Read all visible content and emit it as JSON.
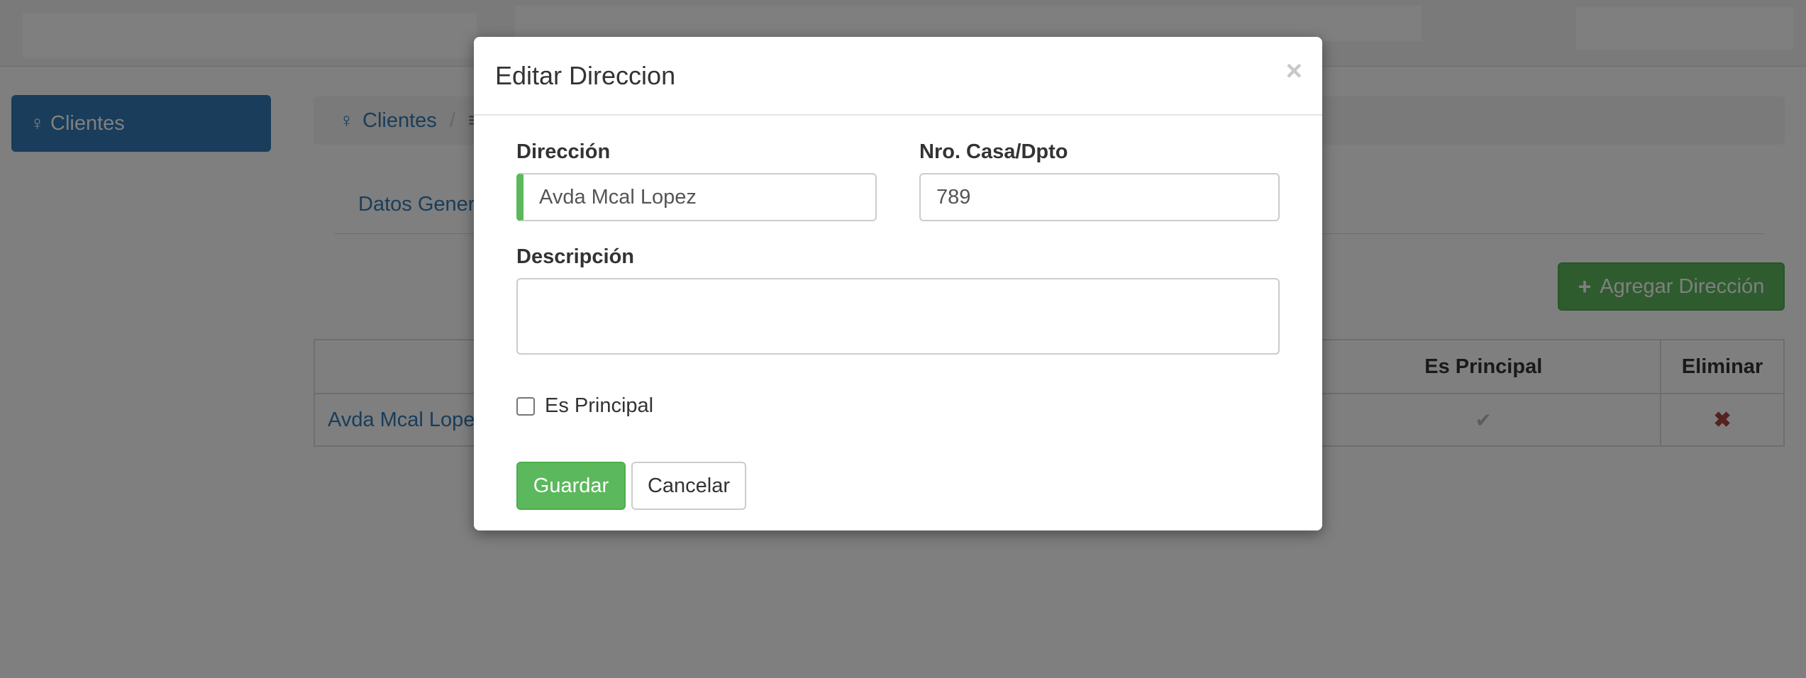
{
  "sidebar": {
    "clientes_label": "Clientes",
    "clientes_icon": "user-icon"
  },
  "breadcrumb": {
    "item1": "Clientes",
    "separator": "/"
  },
  "tabs": {
    "datos_generales": "Datos Genera"
  },
  "actions": {
    "add_address": "Agregar Dirección"
  },
  "table": {
    "headers": {
      "es_principal": "Es Principal",
      "eliminar": "Eliminar"
    },
    "rows": [
      {
        "direccion": "Avda Mcal Lopez"
      }
    ]
  },
  "modal": {
    "title": "Editar Direccion",
    "close_glyph": "×",
    "direccion_label": "Dirección",
    "direccion_value": "Avda Mcal Lopez",
    "nro_label": "Nro. Casa/Dpto",
    "nro_value": "789",
    "descripcion_label": "Descripción",
    "descripcion_value": "",
    "es_principal_label": "Es Principal",
    "es_principal_checked": false,
    "save_label": "Guardar",
    "cancel_label": "Cancelar"
  },
  "colors": {
    "primary": "#337ab7",
    "success": "#5cb85c",
    "danger": "#a94442"
  }
}
